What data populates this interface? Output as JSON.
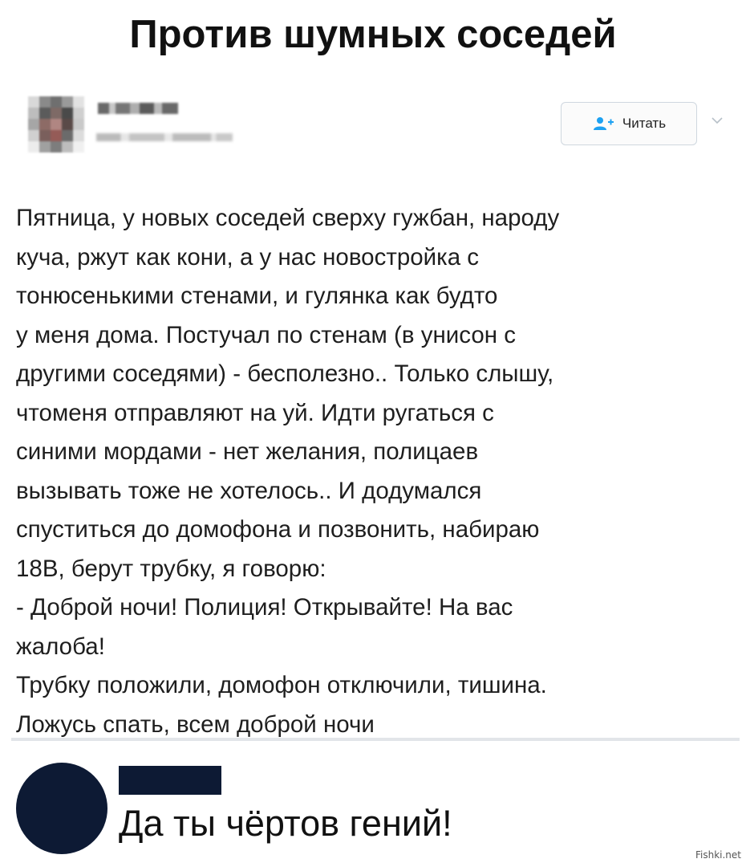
{
  "header": {
    "title": "Против шумных соседей"
  },
  "tweet": {
    "follow_label": "Читать",
    "lines": [
      "Пятница, у новых соседей сверху гужбан, народу",
      "куча, ржут как кони, а у нас новостройка с",
      "тонюсенькими стенами, и гулянка как будто",
      "у меня дома. Постучал по стенам (в унисон с",
      "другими соседями) - бесполезно.. Только слышу,",
      "чтоменя отправляют на уй. Идти ругаться с",
      "синими мордами - нет желания, полицаев",
      "вызывать тоже не хотелось.. И додумался",
      "спуститься до домофона и позвонить, набираю",
      "18В, берут трубку, я говорю:",
      "- Доброй ночи! Полиция! Открывайте! На вас",
      "жалоба!",
      "Трубку положили, домофон отключили, тишина.",
      "Ложусь спать, всем доброй ночи"
    ]
  },
  "reply": {
    "text": "Да ты чёртов гений!"
  },
  "watermark": "Fishki.net",
  "colors": {
    "accent": "#1da1f2",
    "reply_avatar": "#0d1a34",
    "divider": "#e2e5e9"
  },
  "icons": {
    "follow": "add-user-icon",
    "menu": "chevron-down-icon"
  }
}
